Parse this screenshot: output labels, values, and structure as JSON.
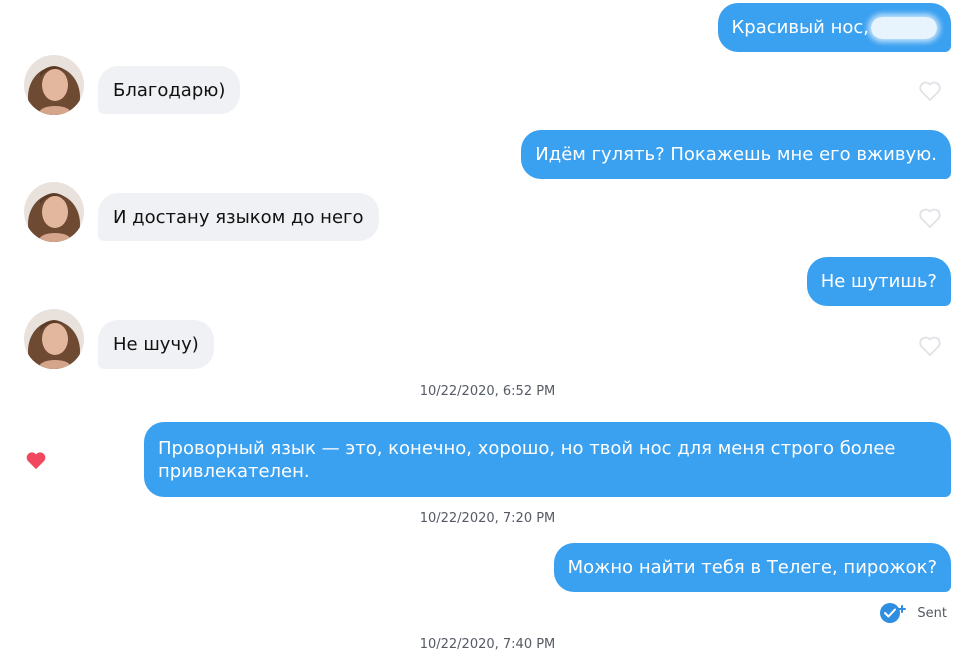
{
  "conversation": {
    "messages": [
      {
        "dir": "out",
        "text": "Красивый нос,"
      },
      {
        "dir": "in",
        "text": "Благодарю)"
      },
      {
        "dir": "out",
        "text": "Идём гулять? Покажешь мне его вживую."
      },
      {
        "dir": "in",
        "text": "И достану языком до него"
      },
      {
        "dir": "out",
        "text": "Не шутишь?"
      },
      {
        "dir": "in",
        "text": "Не шучу)"
      },
      {
        "dir": "out",
        "text": "Проворный язык — это, конечно, хорошо, но твой нос для меня строго более привлекателен."
      },
      {
        "dir": "out",
        "text": "Можно найти тебя в Телеге, пирожок?"
      }
    ],
    "timestamps": [
      "10/22/2020, 6:52 PM",
      "10/22/2020, 7:20 PM",
      "10/22/2020, 7:40 PM"
    ],
    "status": {
      "label": "Sent",
      "icon": "double-check-icon"
    },
    "liked_message_icon": "heart-filled-icon",
    "like_button_icon": "heart-outline-icon",
    "colors": {
      "outgoing": "#3aa0f0",
      "incoming": "#f0f1f4",
      "like": "#f2485e",
      "read": "#2f8ee0"
    }
  }
}
